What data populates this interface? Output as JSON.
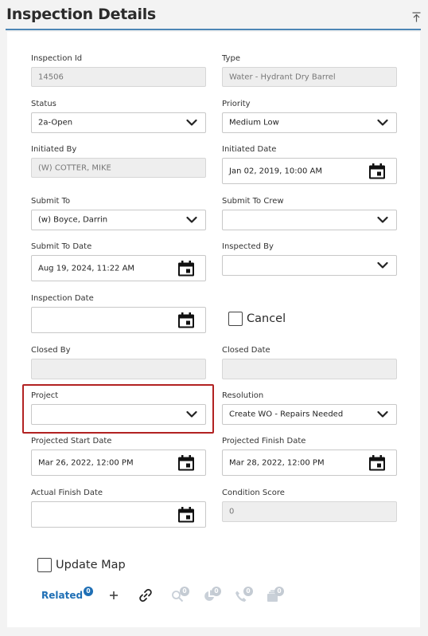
{
  "header": {
    "title": "Inspection Details"
  },
  "fields": {
    "inspection_id": {
      "label": "Inspection Id",
      "value": "14506"
    },
    "type": {
      "label": "Type",
      "value": "Water - Hydrant Dry Barrel"
    },
    "status": {
      "label": "Status",
      "value": "2a-Open"
    },
    "priority": {
      "label": "Priority",
      "value": "Medium Low"
    },
    "initiated_by": {
      "label": "Initiated By",
      "value": "(W) COTTER, MIKE"
    },
    "initiated_date": {
      "label": "Initiated Date",
      "value": "Jan 02, 2019, 10:00 AM"
    },
    "submit_to": {
      "label": "Submit To",
      "value": "(w) Boyce, Darrin"
    },
    "submit_to_crew": {
      "label": "Submit To Crew",
      "value": ""
    },
    "submit_to_date": {
      "label": "Submit To Date",
      "value": "Aug 19, 2024, 11:22 AM"
    },
    "inspected_by": {
      "label": "Inspected By",
      "value": ""
    },
    "inspection_date": {
      "label": "Inspection Date",
      "value": ""
    },
    "closed_by": {
      "label": "Closed By",
      "value": ""
    },
    "closed_date": {
      "label": "Closed Date",
      "value": ""
    },
    "project": {
      "label": "Project",
      "value": ""
    },
    "resolution": {
      "label": "Resolution",
      "value": "Create WO - Repairs Needed"
    },
    "projected_start_date": {
      "label": "Projected Start Date",
      "value": "Mar 26, 2022, 12:00 PM"
    },
    "projected_finish_date": {
      "label": "Projected Finish Date",
      "value": "Mar 28, 2022, 12:00 PM"
    },
    "actual_finish_date": {
      "label": "Actual Finish Date",
      "value": ""
    },
    "condition_score": {
      "label": "Condition Score",
      "value": "0"
    }
  },
  "checkboxes": {
    "cancel": "Cancel",
    "update_map": "Update Map"
  },
  "related": {
    "label": "Related",
    "count": "0",
    "badges": [
      "0",
      "0",
      "0",
      "0",
      "0"
    ],
    "icons": [
      "add-icon",
      "link-icon",
      "search-related-icon",
      "pie-chart-icon",
      "phone-icon",
      "folder-stack-icon"
    ]
  },
  "colors": {
    "accent": "#1f6fb5",
    "highlight": "#b22222",
    "underline": "#4d86b5"
  }
}
